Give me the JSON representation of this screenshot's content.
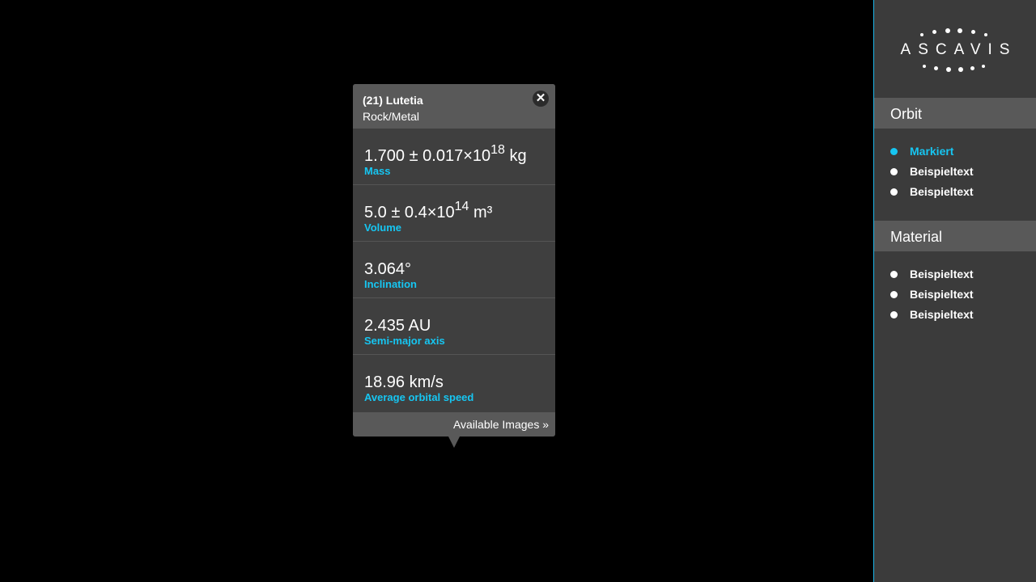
{
  "popup": {
    "title": "(21) Lutetia",
    "subtitle": "Rock/Metal",
    "close_symbol": "✕",
    "properties": [
      {
        "value_base": "1.700 ± 0.017×10",
        "value_exp": "18",
        "value_unit": " kg",
        "label": "Mass"
      },
      {
        "value_base": "5.0 ± 0.4×10",
        "value_exp": "14",
        "value_unit": " m³",
        "label": "Volume"
      },
      {
        "value_base": "3.064°",
        "value_exp": "",
        "value_unit": "",
        "label": "Inclination"
      },
      {
        "value_base": "2.435 AU",
        "value_exp": "",
        "value_unit": "",
        "label": "Semi-major axis"
      },
      {
        "value_base": "18.96 km/s",
        "value_exp": "",
        "value_unit": "",
        "label": "Average orbital speed"
      }
    ],
    "footer_link": "Available Images »"
  },
  "sidebar": {
    "logo_text": "ASCAVIS",
    "sections": [
      {
        "title": "Orbit",
        "items": [
          {
            "label": "Markiert",
            "active": true
          },
          {
            "label": "Beispieltext",
            "active": false
          },
          {
            "label": "Beispieltext",
            "active": false
          }
        ]
      },
      {
        "title": "Material",
        "items": [
          {
            "label": "Beispieltext",
            "active": false
          },
          {
            "label": "Beispieltext",
            "active": false
          },
          {
            "label": "Beispieltext",
            "active": false
          }
        ]
      }
    ]
  },
  "colors": {
    "accent": "#16c6f2",
    "panel": "#3f3f3f",
    "header": "#595959",
    "background": "#000000"
  }
}
